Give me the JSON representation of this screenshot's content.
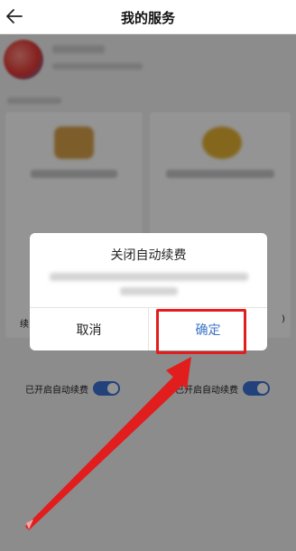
{
  "header": {
    "title": "我的服务",
    "back_icon": "back-arrow-icon"
  },
  "dialog": {
    "title": "关闭自动续费",
    "cancel_label": "取消",
    "confirm_label": "确定"
  },
  "services": {
    "left_toggle_label": "已开启自动续费",
    "right_toggle_label": "已开启自动续费",
    "left_toggle_on": true,
    "right_toggle_on": true
  },
  "background_edge": {
    "left_fragment": "续",
    "right_fragment": ")"
  },
  "colors": {
    "accent_blue": "#3b73c9",
    "toggle_blue": "#3d73d6",
    "annotation_red": "#e11d1d"
  }
}
